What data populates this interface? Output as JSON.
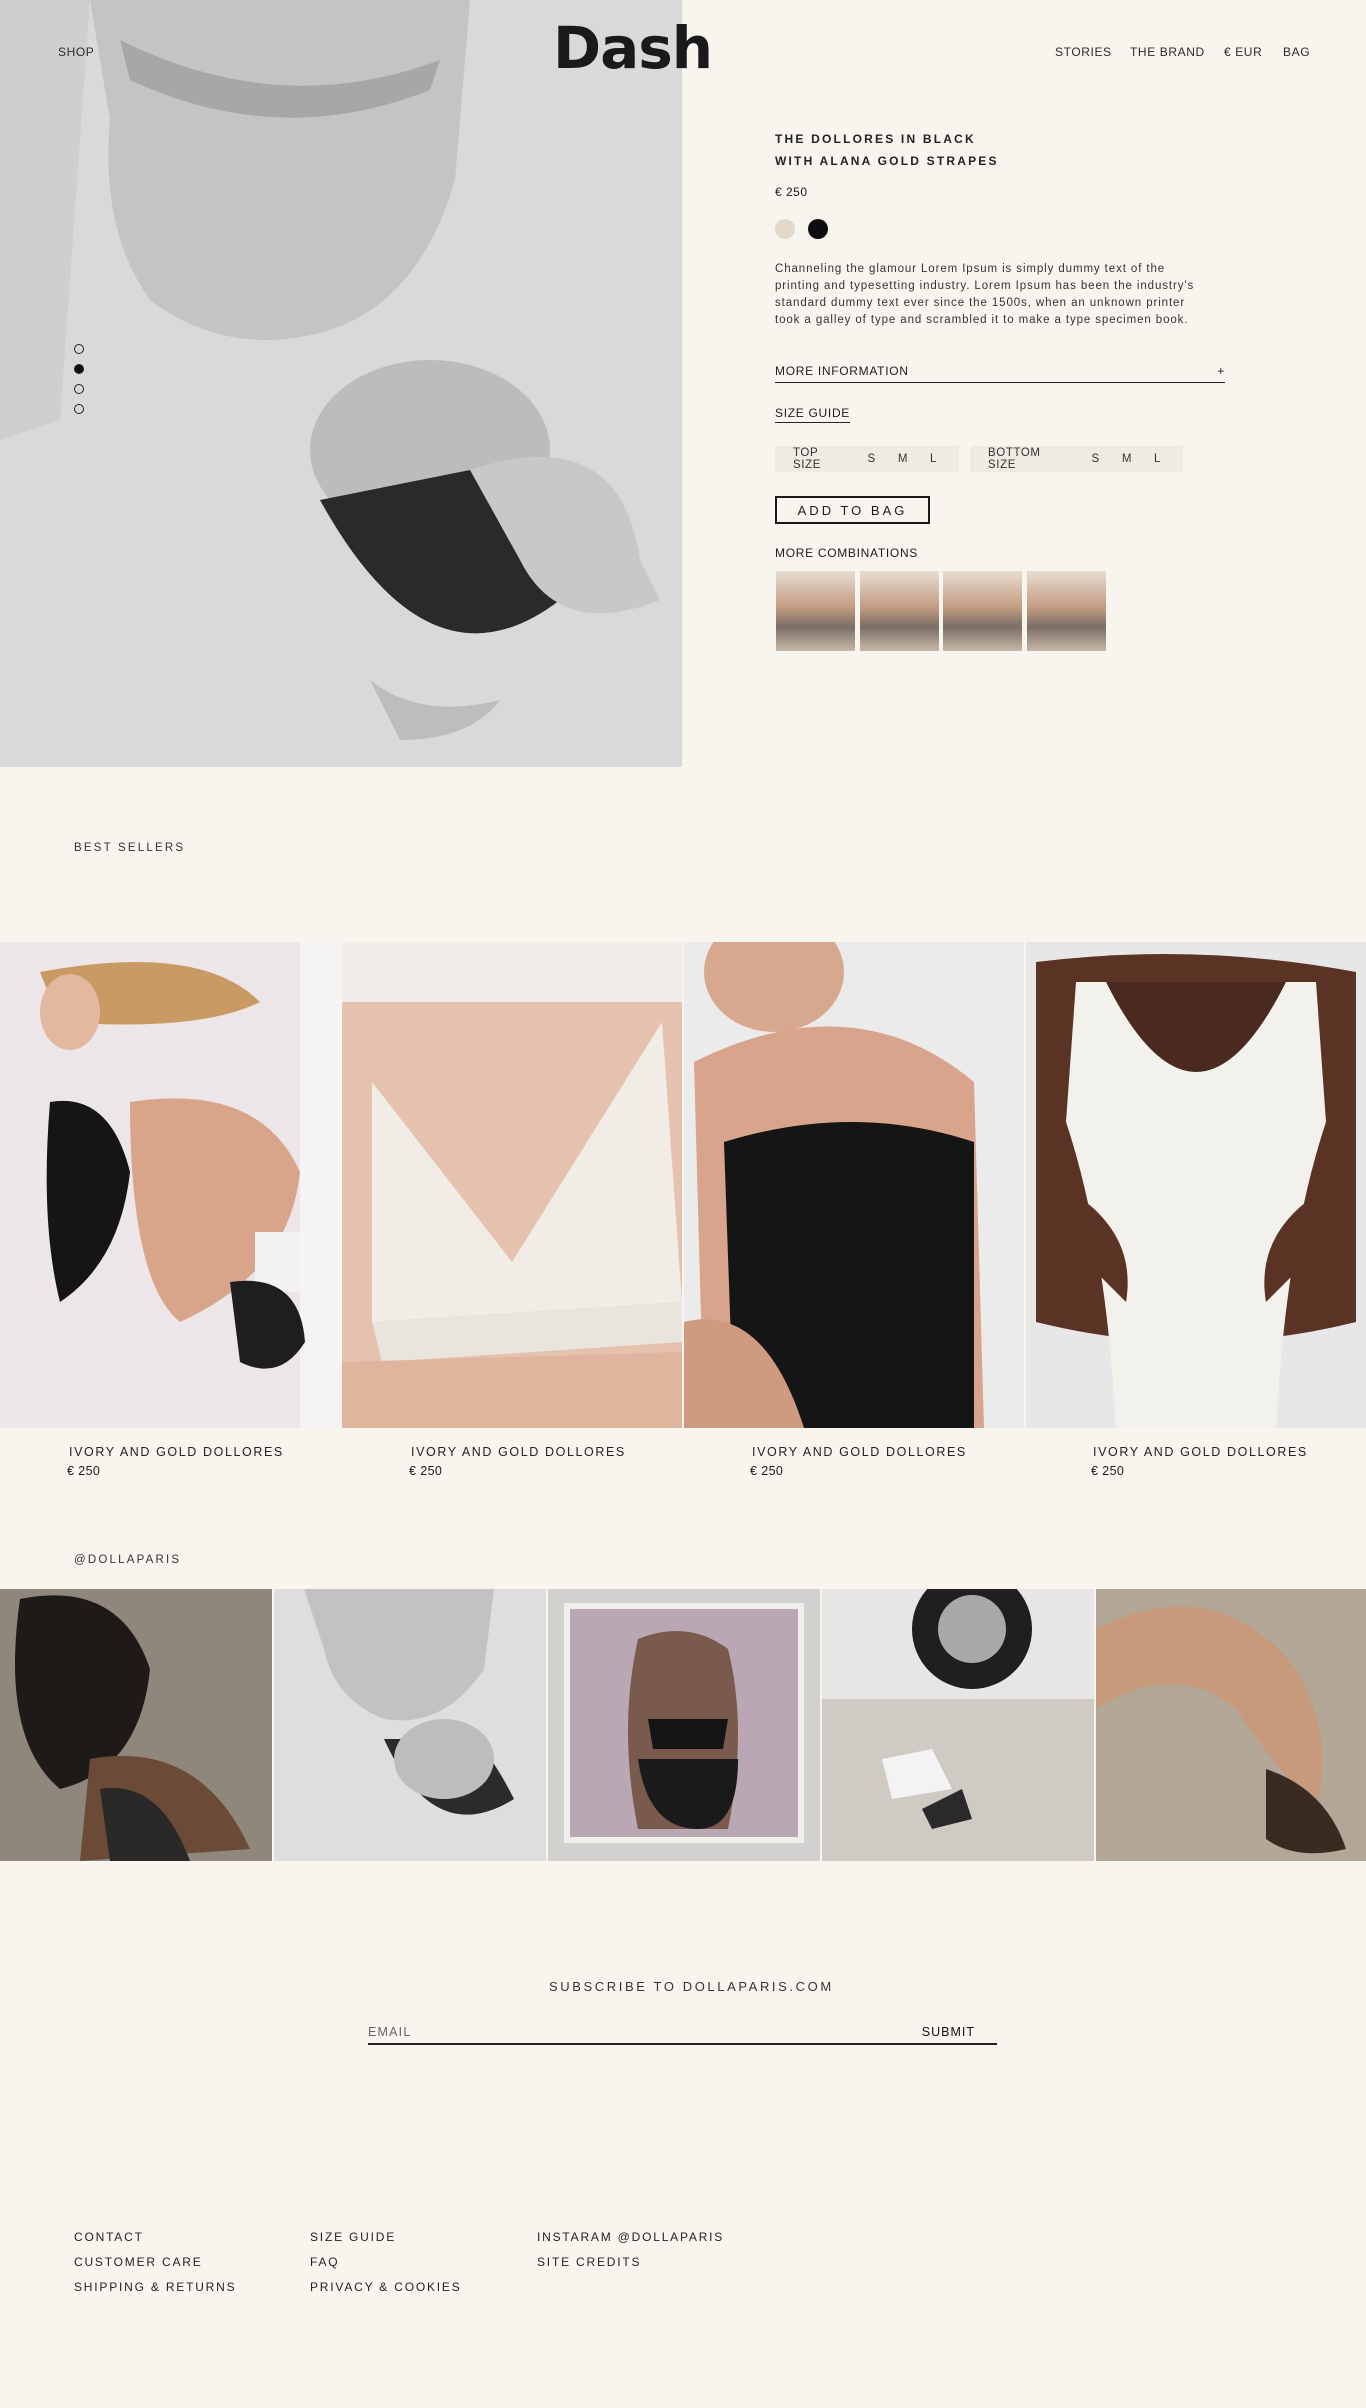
{
  "header": {
    "shop_label": "SHOP",
    "logo_text": "Dash",
    "nav": [
      "STORIES",
      "THE BRAND",
      "€ EUR",
      "BAG"
    ]
  },
  "hero": {
    "slide_count": 4,
    "active_slide": 2
  },
  "product": {
    "title_line1": "THE DOLLORES IN BLACK",
    "title_line2": "WITH ALANA GOLD STRAPES",
    "price": "€ 250",
    "colors": [
      "#e2d9cb",
      "#0d0d0d"
    ],
    "description": "Channeling the glamour Lorem Ipsum is simply dummy text of the printing and typesetting industry. Lorem Ipsum has been the industry's standard dummy text ever since the 1500s, when an unknown printer took a galley of type and scrambled it to make a type specimen book.",
    "more_info_label": "MORE INFORMATION",
    "more_info_toggle": "+",
    "size_guide_label": "SIZE GUIDE",
    "top_size": {
      "label": "TOP SIZE",
      "options": [
        "S",
        "M",
        "L"
      ]
    },
    "bottom_size": {
      "label": "BOTTOM SIZE",
      "options": [
        "S",
        "M",
        "L"
      ]
    },
    "add_to_bag_label": "ADD TO BAG",
    "more_combinations_label": "MORE COMBINATIONS"
  },
  "best_sellers": {
    "label": "BEST SELLERS",
    "items": [
      {
        "name": "IVORY AND GOLD DOLLORES",
        "price": "€ 250"
      },
      {
        "name": "IVORY AND GOLD DOLLORES",
        "price": "€ 250"
      },
      {
        "name": "IVORY AND GOLD DOLLORES",
        "price": "€ 250"
      },
      {
        "name": "IVORY AND GOLD DOLLORES",
        "price": "€ 250"
      }
    ]
  },
  "instagram": {
    "handle": "@DOLLAPARIS"
  },
  "subscribe": {
    "title": "SUBSCRIBE TO DOLLAPARIS.COM",
    "email_placeholder": "EMAIL",
    "submit_label": "SUBMIT"
  },
  "footer": {
    "col1": [
      "CONTACT",
      "CUSTOMER CARE",
      "SHIPPING & RETURNS"
    ],
    "col2": [
      "SIZE GUIDE",
      "FAQ",
      "PRIVACY & COOKIES"
    ],
    "col3": [
      "INSTARAM @DOLLAPARIS",
      "SITE CREDITS"
    ]
  }
}
